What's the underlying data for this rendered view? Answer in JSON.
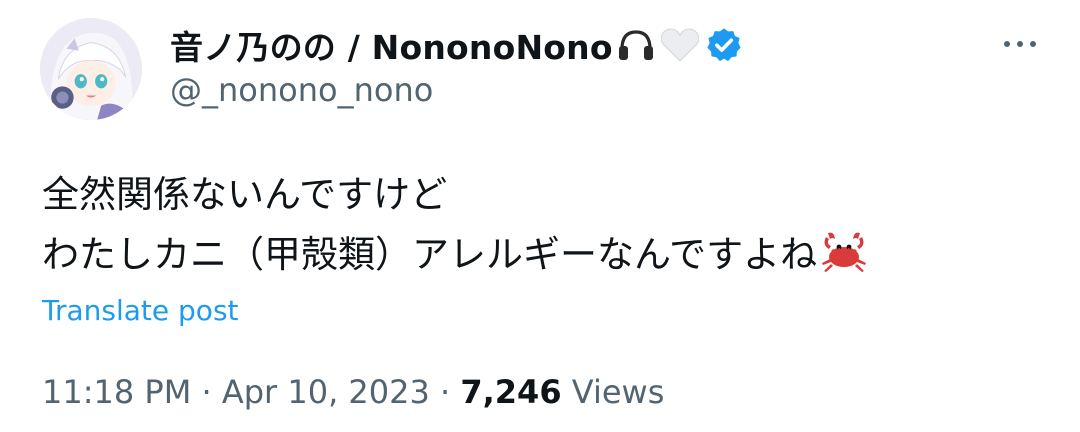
{
  "author": {
    "display_name": "音ノ乃のの / NononoNono",
    "handle": "@_nonono_nono",
    "name_icons": [
      "headphones-icon",
      "white-heart-icon",
      "verified-badge-icon"
    ],
    "verified_color": "#1d9bf0"
  },
  "post": {
    "lines": [
      "全然関係ないんですけど",
      "わたしカニ（甲殻類）アレルギーなんですよね"
    ],
    "trailing_emoji": "crab-emoji",
    "translate_label": "Translate post"
  },
  "meta": {
    "time": "11:18 PM",
    "separator": "·",
    "date": "Apr 10, 2023",
    "views_count": "7,246",
    "views_label": "Views"
  },
  "colors": {
    "text": "#0f1419",
    "secondary": "#536471",
    "link": "#1d9bf0"
  }
}
